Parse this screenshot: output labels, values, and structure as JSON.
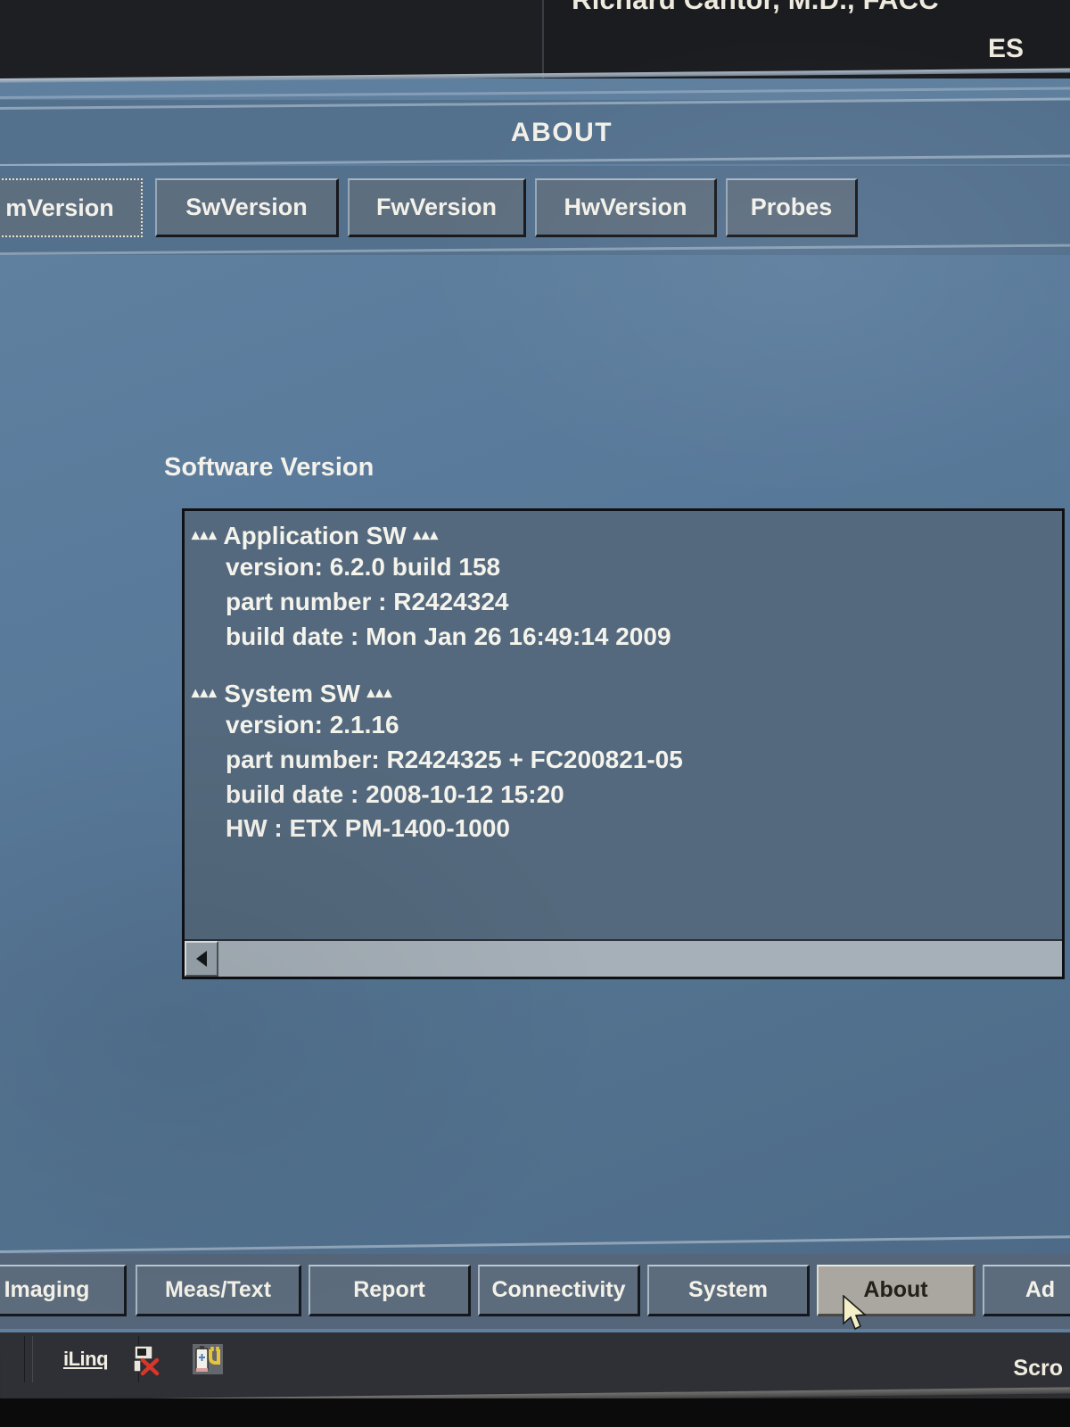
{
  "header": {
    "physician": "Richard Cantor, M.D., FACC",
    "language_code": "ES"
  },
  "title": {
    "screen_title": "ABOUT"
  },
  "tabs": [
    {
      "label": "mVersion",
      "selected": true
    },
    {
      "label": "SwVersion",
      "selected": false
    },
    {
      "label": "FwVersion",
      "selected": false
    },
    {
      "label": "HwVersion",
      "selected": false
    },
    {
      "label": "Probes",
      "selected": false
    }
  ],
  "content": {
    "section_label": "Software Version",
    "blocks": [
      {
        "heading": "Application SW",
        "star_prefix": "▴▴▴",
        "star_suffix": "▴▴▴",
        "lines": [
          "version: 6.2.0 build 158",
          "part number : R2424324",
          "build date : Mon Jan 26 16:49:14 2009"
        ]
      },
      {
        "heading": "System SW",
        "star_prefix": "▴▴▴",
        "star_suffix": "▴▴▴",
        "lines": [
          "version: 2.1.16",
          "part number: R2424325 + FC200821-05",
          "build date : 2008-10-12 15:20",
          "HW : ETX PM-1400-1000"
        ]
      }
    ]
  },
  "menu": [
    {
      "label": "Imaging",
      "active": false
    },
    {
      "label": "Meas/Text",
      "active": false
    },
    {
      "label": "Report",
      "active": false
    },
    {
      "label": "Connectivity",
      "active": false
    },
    {
      "label": "System",
      "active": false
    },
    {
      "label": "About",
      "active": true
    },
    {
      "label": "Ad",
      "active": false
    }
  ],
  "taskbar": {
    "ilinq_label": "iLinq",
    "network_icon": "network-disconnected-icon",
    "power_icon": "power-plug-icon",
    "scroll_label": "Scro"
  },
  "colors": {
    "background": "#5f7f9e",
    "panel": "#54697d",
    "chrome": "#53708d",
    "text": "#f4f3ec",
    "dark_bar": "#1b1c20",
    "active_button": "#a9a79f"
  }
}
